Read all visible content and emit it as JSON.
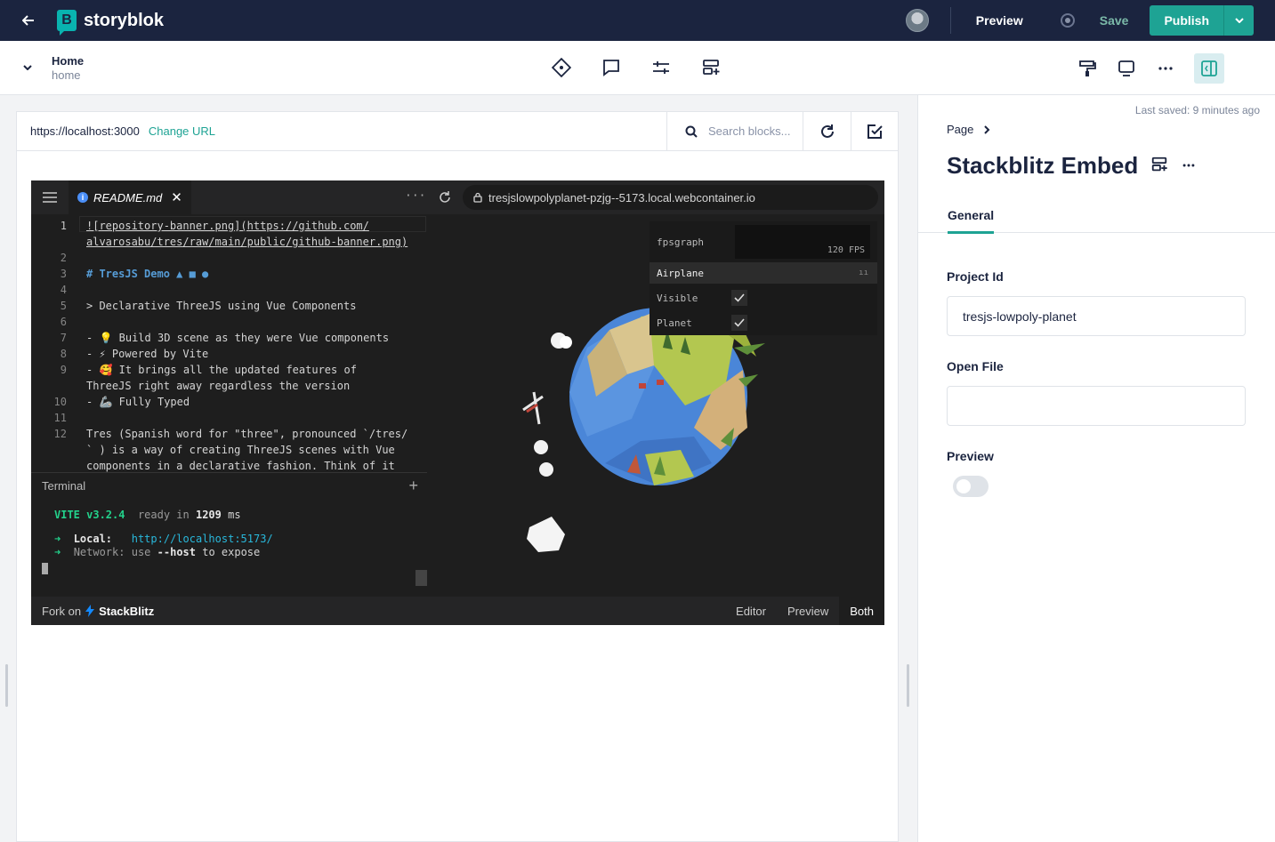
{
  "topbar": {
    "logo_text": "storyblok",
    "logo_letter": "B",
    "preview_label": "Preview",
    "save_label": "Save",
    "publish_label": "Publish"
  },
  "story": {
    "title": "Home",
    "slug": "home"
  },
  "preview_frame": {
    "url": "https://localhost:3000",
    "change_url_label": "Change URL",
    "search_placeholder": "Search blocks..."
  },
  "stackblitz": {
    "tab_label": "README.md",
    "more": "···",
    "preview_url": "tresjslowpolyplanet-pzjg--5173.local.webcontainer.io",
    "code_lines": [
      {
        "n": "1",
        "text": "![repository-banner.png](https://github.com/"
      },
      {
        "n": "",
        "text": "alvarosabu/tres/raw/main/public/github-banner.png)"
      },
      {
        "n": "2",
        "text": ""
      },
      {
        "n": "3",
        "text": "# TresJS Demo ▲ ■ ●"
      },
      {
        "n": "4",
        "text": ""
      },
      {
        "n": "5",
        "text": "> Declarative ThreeJS using Vue Components"
      },
      {
        "n": "6",
        "text": ""
      },
      {
        "n": "7",
        "text": "- 💡 Build 3D scene as they were Vue components"
      },
      {
        "n": "8",
        "text": "- ⚡ Powered by Vite"
      },
      {
        "n": "9",
        "text": "- 🥰 It brings all the updated features of"
      },
      {
        "n": "",
        "text": "ThreeJS right away regardless the version"
      },
      {
        "n": "10",
        "text": "- 🦾 Fully Typed"
      },
      {
        "n": "11",
        "text": ""
      },
      {
        "n": "12",
        "text": "Tres (Spanish word for \"three\", pronounced `/tres/"
      },
      {
        "n": "",
        "text": "` ) is a way of creating ThreeJS scenes with Vue"
      },
      {
        "n": "",
        "text": "components in a declarative fashion. Think of it"
      }
    ],
    "terminal_label": "Terminal",
    "terminal": {
      "vite": "VITE v3.2.4",
      "ready": "ready in",
      "ms": "1209",
      "ms_unit": "ms",
      "local_label": "Local:",
      "local_url": "http://localhost:5173/",
      "network_label": "Network:",
      "network_use": "use",
      "network_flag": "--host",
      "network_rest": "to expose"
    },
    "gui": {
      "fpsgraph_label": "fpsgraph",
      "fps_value": "120",
      "fps_unit": "FPS",
      "folder": "Airplane",
      "visible_label": "Visible",
      "planet_label": "Planet",
      "visible_checked": true,
      "planet_checked": true
    },
    "fork_on": "Fork on",
    "brand": "StackBlitz",
    "views": [
      "Editor",
      "Preview",
      "Both"
    ],
    "active_view": "Both"
  },
  "panel": {
    "last_saved": "Last saved: 9 minutes ago",
    "breadcrumb": "Page",
    "title": "Stackblitz Embed",
    "tab": "General",
    "fields": {
      "project_id_label": "Project Id",
      "project_id_value": "tresjs-lowpoly-planet",
      "open_file_label": "Open File",
      "open_file_value": "",
      "preview_label": "Preview",
      "preview_on": false
    }
  },
  "colors": {
    "topbar_bg": "#1b243f",
    "accent": "#1ea394",
    "editor_bg": "#1e1e1e"
  }
}
